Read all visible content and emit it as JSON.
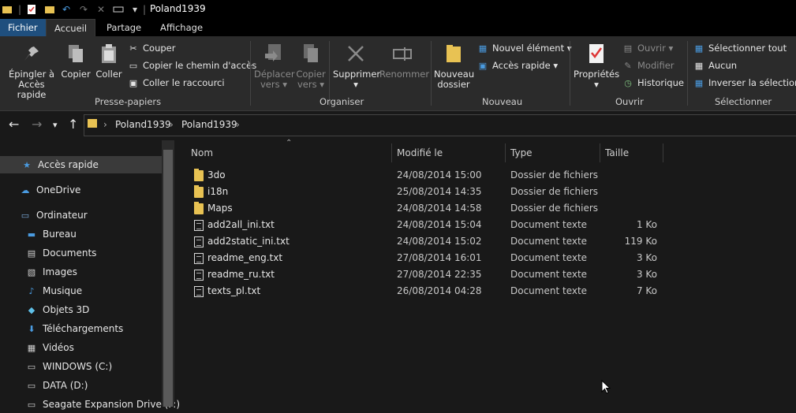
{
  "window": {
    "title": "Poland1939"
  },
  "tabs": [
    {
      "label": "Fichier"
    },
    {
      "label": "Accueil"
    },
    {
      "label": "Partage"
    },
    {
      "label": "Affichage"
    }
  ],
  "ribbon": {
    "clipboard": {
      "group_label": "Presse-papiers",
      "pin_line1": "Épingler à",
      "pin_line2": "Accès rapide",
      "copy": "Copier",
      "paste": "Coller",
      "cut": "Couper",
      "copy_path": "Copier le chemin d'accès",
      "paste_shortcut": "Coller le raccourci"
    },
    "organize": {
      "group_label": "Organiser",
      "move_line1": "Déplacer",
      "move_line2": "vers",
      "copyto_line1": "Copier",
      "copyto_line2": "vers",
      "delete": "Supprimer",
      "rename": "Renommer"
    },
    "new": {
      "group_label": "Nouveau",
      "folder_line1": "Nouveau",
      "folder_line2": "dossier",
      "new_item": "Nouvel élément",
      "easy_access": "Accès rapide"
    },
    "open": {
      "group_label": "Ouvrir",
      "properties": "Propriétés",
      "open": "Ouvrir",
      "edit": "Modifier",
      "history": "Historique"
    },
    "select": {
      "group_label": "Sélectionner",
      "select_all": "Sélectionner tout",
      "select_none": "Aucun",
      "invert": "Inverser la sélection"
    }
  },
  "address": {
    "crumbs": [
      "Poland1939",
      "Poland1939"
    ]
  },
  "sidebar": {
    "items": [
      {
        "label": "Accès rapide",
        "icon": "star-icon"
      },
      {
        "label": "OneDrive",
        "icon": "cloud-icon"
      },
      {
        "label": "Ordinateur",
        "icon": "computer-icon"
      },
      {
        "label": "Bureau",
        "icon": "desktop-icon"
      },
      {
        "label": "Documents",
        "icon": "documents-icon"
      },
      {
        "label": "Images",
        "icon": "images-icon"
      },
      {
        "label": "Musique",
        "icon": "music-icon"
      },
      {
        "label": "Objets 3D",
        "icon": "cube-icon"
      },
      {
        "label": "Téléchargements",
        "icon": "download-icon"
      },
      {
        "label": "Vidéos",
        "icon": "video-icon"
      },
      {
        "label": "WINDOWS (C:)",
        "icon": "drive-icon"
      },
      {
        "label": "DATA (D:)",
        "icon": "drive-icon"
      },
      {
        "label": "Seagate Expansion Drive (F:)",
        "icon": "drive-icon"
      }
    ]
  },
  "filelist": {
    "columns": {
      "name": "Nom",
      "modified": "Modifié le",
      "type": "Type",
      "size": "Taille"
    },
    "rows": [
      {
        "name": "3do",
        "modified": "24/08/2014 15:00",
        "type": "Dossier de fichiers",
        "size": "",
        "kind": "folder"
      },
      {
        "name": "i18n",
        "modified": "25/08/2014 14:35",
        "type": "Dossier de fichiers",
        "size": "",
        "kind": "folder"
      },
      {
        "name": "Maps",
        "modified": "24/08/2014 14:58",
        "type": "Dossier de fichiers",
        "size": "",
        "kind": "folder"
      },
      {
        "name": "add2all_ini.txt",
        "modified": "24/08/2014 15:04",
        "type": "Document texte",
        "size": "1 Ko",
        "kind": "file"
      },
      {
        "name": "add2static_ini.txt",
        "modified": "24/08/2014 15:02",
        "type": "Document texte",
        "size": "119 Ko",
        "kind": "file"
      },
      {
        "name": "readme_eng.txt",
        "modified": "27/08/2014 16:01",
        "type": "Document texte",
        "size": "3 Ko",
        "kind": "file"
      },
      {
        "name": "readme_ru.txt",
        "modified": "27/08/2014 22:35",
        "type": "Document texte",
        "size": "3 Ko",
        "kind": "file"
      },
      {
        "name": "texts_pl.txt",
        "modified": "26/08/2014 04:28",
        "type": "Document texte",
        "size": "7 Ko",
        "kind": "file"
      }
    ]
  },
  "colors": {
    "background": "#191919",
    "ribbon": "#2b2b2b",
    "file_tab": "#1f4f7e",
    "folder": "#e8c253",
    "accent_blue": "#4a9be0"
  }
}
